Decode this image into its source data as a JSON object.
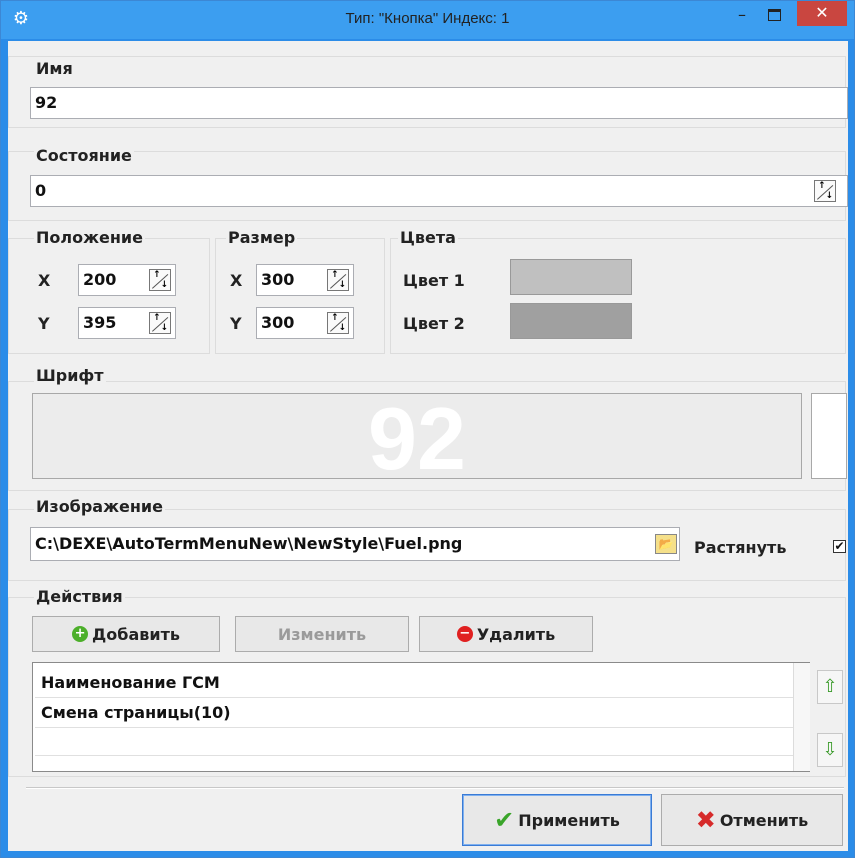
{
  "window": {
    "title": "Тип: \"Кнопка\" Индекс: 1",
    "icon": "gear-icon",
    "minimize_glyph": "–",
    "close_glyph": "✕"
  },
  "name_group": {
    "title": "Имя",
    "value": "92"
  },
  "state_group": {
    "title": "Состояние",
    "value": "0"
  },
  "position_group": {
    "title": "Положение",
    "x_label": "X",
    "x_value": "200",
    "y_label": "Y",
    "y_value": "395"
  },
  "size_group": {
    "title": "Размер",
    "x_label": "X",
    "x_value": "300",
    "y_label": "Y",
    "y_value": "300"
  },
  "colors_group": {
    "title": "Цвета",
    "color1_label": "Цвет 1",
    "color1": "#c0c0c0",
    "color2_label": "Цвет 2",
    "color2": "#a0a0a0"
  },
  "font_group": {
    "title": "Шрифт",
    "preview_text": "92"
  },
  "image_group": {
    "title": "Изображение",
    "path": "C:\\DEXE\\AutoTermMenuNew\\NewStyle\\Fuel.png",
    "stretch_label": "Растянуть",
    "stretch_checked": true,
    "check_glyph": "✔"
  },
  "actions_group": {
    "title": "Действия",
    "add_label": "Добавить",
    "edit_label": "Изменить",
    "delete_label": "Удалить",
    "items": [
      "Наименование ГСМ",
      "Смена страницы(10)"
    ]
  },
  "footer": {
    "apply_label": "Применить",
    "cancel_label": "Отменить"
  }
}
